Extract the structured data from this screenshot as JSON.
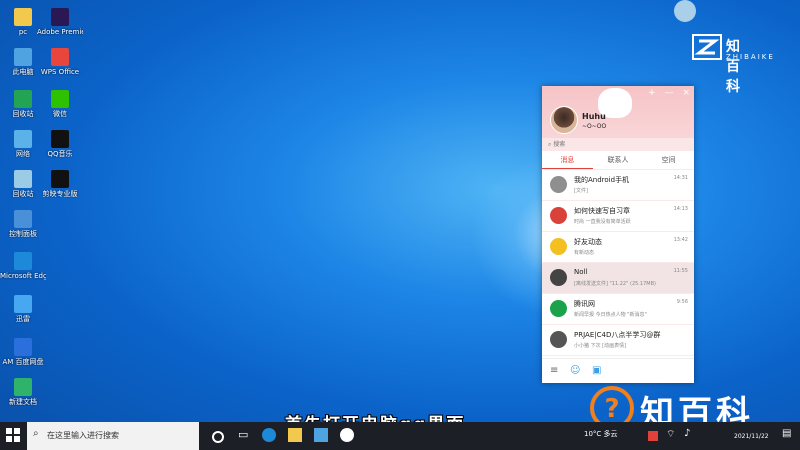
{
  "desktop": {
    "icons": [
      {
        "label": "pc",
        "color": "#f2c94c"
      },
      {
        "label": "Adobe Premiere...",
        "color": "#2a1854"
      },
      {
        "label": "此电脑",
        "color": "#4fa3e0"
      },
      {
        "label": "WPS Office",
        "color": "#e8453c"
      },
      {
        "label": "回收站",
        "color": "#23a455"
      },
      {
        "label": "微信",
        "color": "#2dc100"
      },
      {
        "label": "网络",
        "color": "#5ab2e8"
      },
      {
        "label": "QQ音乐",
        "color": "#111111"
      },
      {
        "label": "回收站",
        "color": "#9ccbe6"
      },
      {
        "label": "剪映专业版",
        "color": "#111111"
      },
      {
        "label": "控制面板",
        "color": "#4a90d9"
      },
      {
        "label": "Microsoft Edge",
        "color": "#1d8ad9"
      },
      {
        "label": "迅雷",
        "color": "#47a7f0"
      },
      {
        "label": "AM 百度网盘",
        "color": "#2a6fdb"
      },
      {
        "label": "新建文档",
        "color": "#2fb36b"
      }
    ]
  },
  "qq": {
    "nickname": "Huhu",
    "signature": "~O~OO",
    "search_placeholder": "搜索",
    "tabs": [
      "消息",
      "联系人",
      "空间"
    ],
    "messages": [
      {
        "title": "我的Android手机",
        "subtitle": "[文件]",
        "time": "14:31",
        "color": "#8f8f8f"
      },
      {
        "title": "如何快速写自习章",
        "subtitle": "时尚 一直我没有简单活跃",
        "time": "14:13",
        "color": "#d9413b"
      },
      {
        "title": "好友动态",
        "subtitle": "有新动态",
        "time": "13:42",
        "color": "#f4c020"
      },
      {
        "title": "Noll",
        "subtitle": "[离线发送文件] \"11.22\" (25.17MB)",
        "time": "11:55",
        "color": "#444444"
      },
      {
        "title": "腾讯网",
        "subtitle": "新闻早报 今日热点人物 \"新消息\"",
        "time": "9:56",
        "color": "#1aa34a"
      },
      {
        "title": "PRJAE|C4D八点半学习@群",
        "subtitle": "小小猪 下次 [动画表情]",
        "time": "",
        "color": "#555555"
      }
    ],
    "controls": {
      "plus": "+",
      "min": "—",
      "close": "×"
    }
  },
  "brand": {
    "top_cn": "知百科",
    "top_en": "ZHIBAIKE",
    "bottom_cn": "知百科"
  },
  "subtitle": "首先打开电脑qq界面",
  "taskbar": {
    "search_placeholder": "在这里输入进行搜索",
    "weather": "10°C 多云",
    "date": "2021/11/22"
  }
}
